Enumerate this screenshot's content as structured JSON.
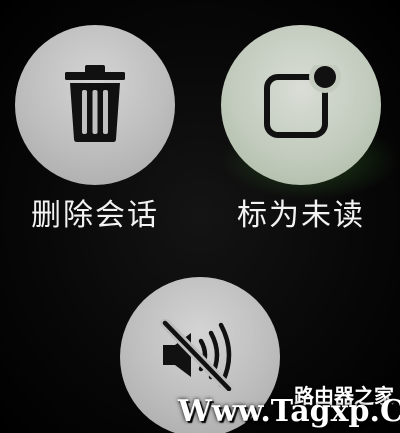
{
  "actions": [
    {
      "label": "删除会话",
      "icon": "trash-icon"
    },
    {
      "label": "标为未读",
      "icon": "unread-badge-icon"
    },
    {
      "label": "",
      "icon": "mute-speaker-icon"
    }
  ],
  "watermark": {
    "line1": "路由器之家",
    "line2": "Www.Tagxp.Com"
  },
  "colors": {
    "button": "#bdbdbd",
    "icon": "#111111",
    "label": "#f2f2f2",
    "glow": "#50be3c"
  }
}
